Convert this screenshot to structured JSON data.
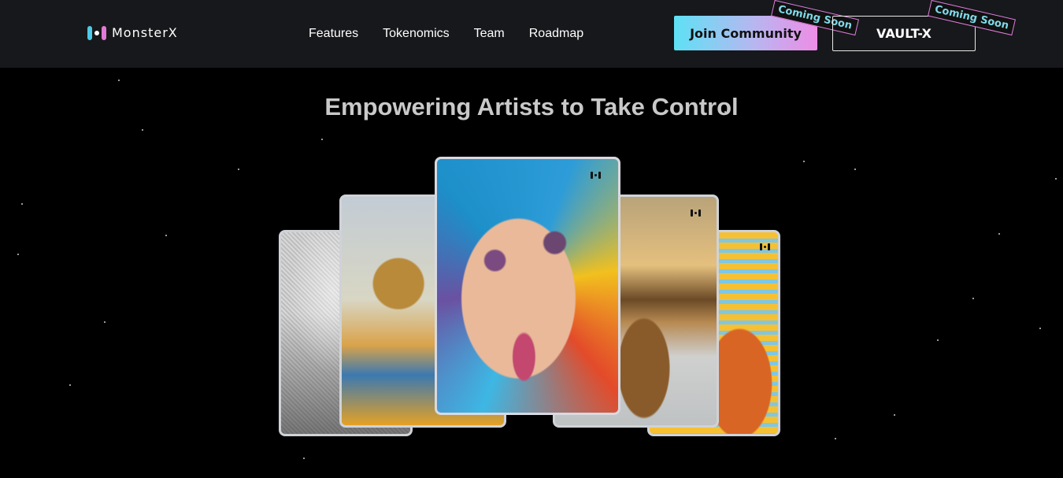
{
  "brand": {
    "name": "MonsterX",
    "logo_colors": [
      "#4ec9e6",
      "#ffffff",
      "#e17ad6"
    ]
  },
  "nav": {
    "items": [
      {
        "label": "Features"
      },
      {
        "label": "Tokenomics"
      },
      {
        "label": "Team"
      },
      {
        "label": "Roadmap"
      }
    ]
  },
  "actions": {
    "join_label": "Join Community",
    "join_badge": "Coming Soon",
    "vault_label": "VAULT-X",
    "vault_badge": "Coming Soon"
  },
  "hero": {
    "title": "Empowering Artists to Take Control"
  },
  "cards": [
    {
      "subject": "vintage engraving"
    },
    {
      "subject": "portrait of elder"
    },
    {
      "subject": "colorful face artwork"
    },
    {
      "subject": "hand holding object"
    },
    {
      "subject": "striped abstract"
    }
  ],
  "colors": {
    "header_bg": "#17181b",
    "page_bg": "#000000",
    "join_gradient": [
      "#5ee1f5",
      "#ee8de6"
    ]
  }
}
